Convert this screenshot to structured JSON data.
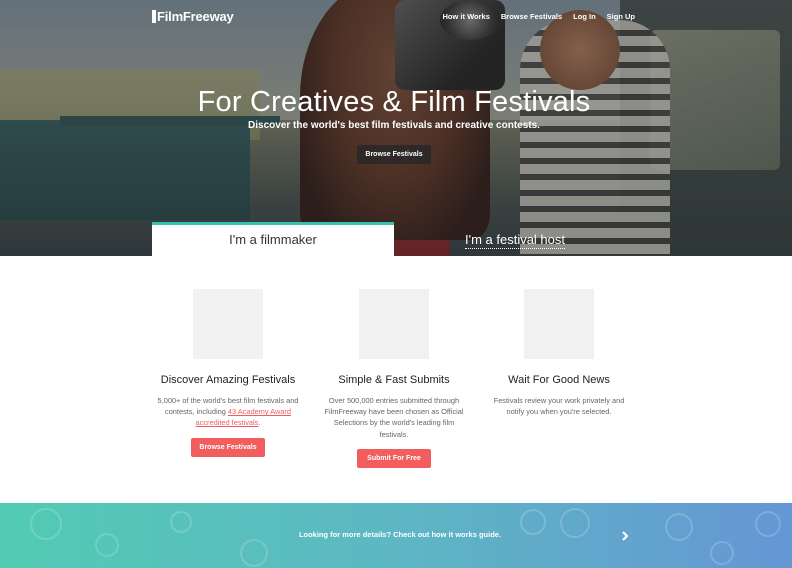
{
  "header": {
    "logo_text": "FilmFreeway",
    "nav": [
      {
        "label": "How it Works"
      },
      {
        "label": "Browse Festivals"
      },
      {
        "label": "Log In"
      },
      {
        "label": "Sign Up"
      }
    ]
  },
  "hero": {
    "title": "For Creatives & Film Festivals",
    "subtitle": "Discover the world's best film festivals and creative contests.",
    "button_label": "Browse Festivals",
    "tabs": [
      {
        "label": "I'm a filmmaker",
        "active": true
      },
      {
        "label": "I'm a festival host",
        "active": false
      }
    ],
    "accent_color": "#35c2b1"
  },
  "features": [
    {
      "title": "Discover Amazing Festivals",
      "text_before": "5,000+ of the world's best film festivals and contests, including ",
      "link_text": "43 Academy Award accredited festivals",
      "text_after": ".",
      "button_label": "Browse Festivals"
    },
    {
      "title": "Simple & Fast Submits",
      "text": "Over 500,000 entries submitted through FilmFreeway have been chosen as Official Selections by the world's leading film festivals.",
      "button_label": "Submit For Free"
    },
    {
      "title": "Wait For Good News",
      "text": "Festivals review your work privately and notify you when you're selected."
    }
  ],
  "banner": {
    "text": "Looking for more details? Check out how it works guide.",
    "arrow_icon": "chevron-right-icon"
  },
  "colors": {
    "button_red": "#f25e5e",
    "banner_start": "#52cbb3",
    "banner_end": "#6596d4"
  }
}
